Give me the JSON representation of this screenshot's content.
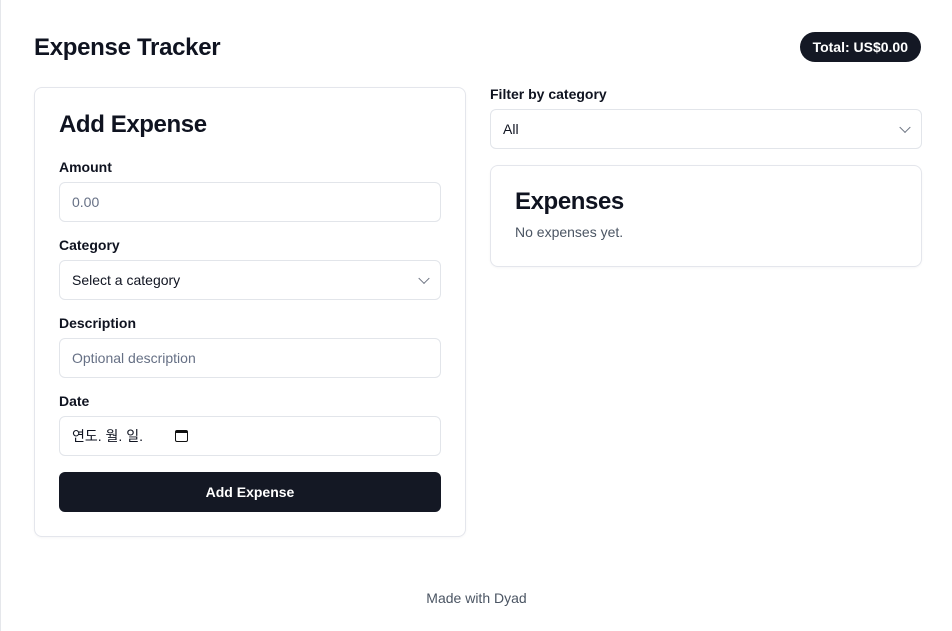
{
  "header": {
    "title": "Expense Tracker",
    "total_badge": "Total: US$0.00"
  },
  "add_form": {
    "title": "Add Expense",
    "amount": {
      "label": "Amount",
      "placeholder": "0.00",
      "value": ""
    },
    "category": {
      "label": "Category",
      "selected": "Select a category"
    },
    "description": {
      "label": "Description",
      "placeholder": "Optional description",
      "value": ""
    },
    "date": {
      "label": "Date",
      "placeholder": "연도. 월. 일.",
      "icon": "calendar-icon"
    },
    "submit_label": "Add Expense"
  },
  "filter": {
    "label": "Filter by category",
    "selected": "All"
  },
  "expenses": {
    "title": "Expenses",
    "empty_text": "No expenses yet."
  },
  "footer": {
    "text": "Made with Dyad"
  },
  "colors": {
    "primary": "#141824",
    "border": "#e2e5ea",
    "muted_text": "#667085"
  }
}
